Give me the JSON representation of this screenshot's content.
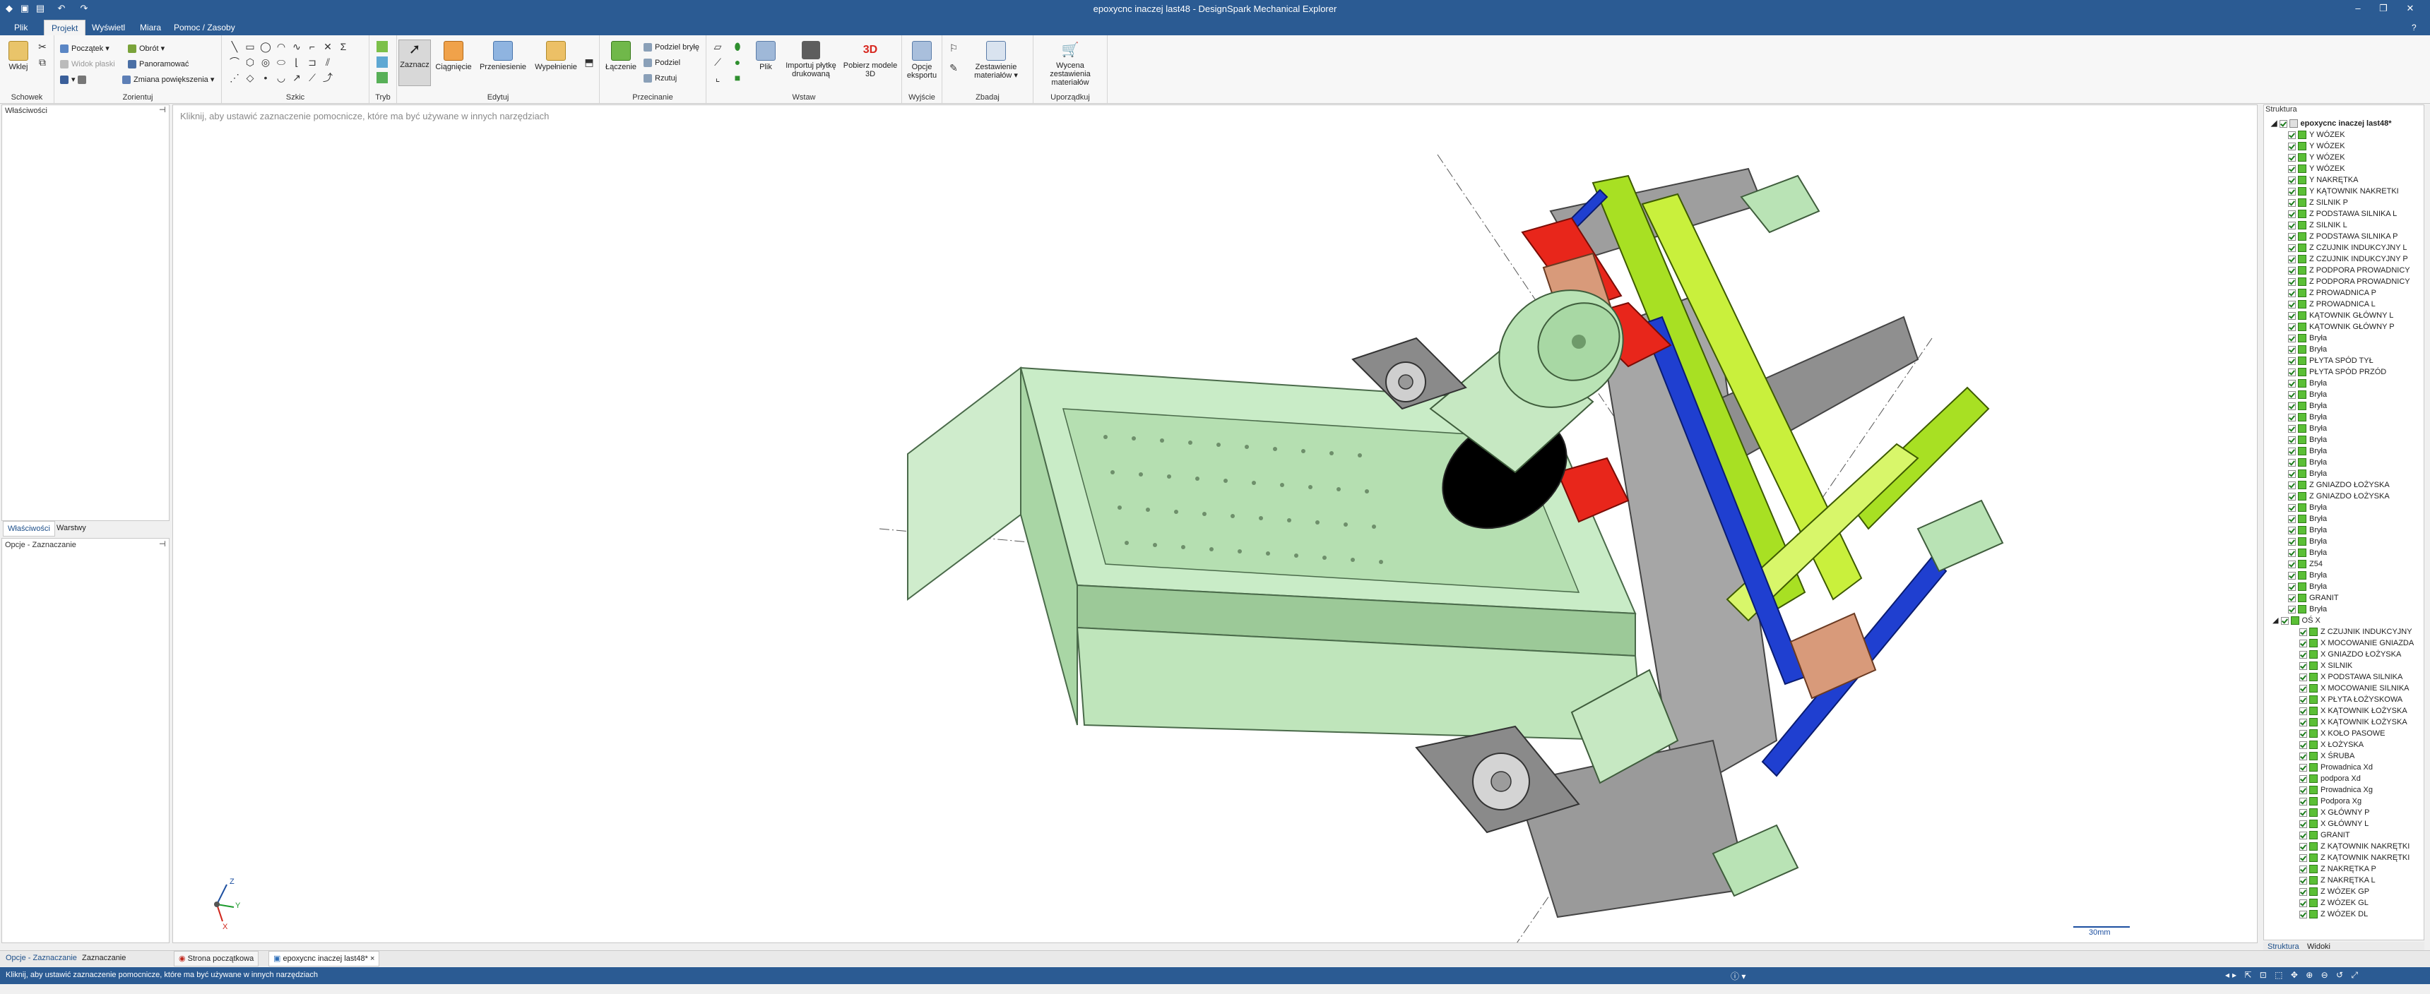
{
  "app": {
    "title": "epoxycnc inaczej last48 - DesignSpark Mechanical Explorer"
  },
  "menu": {
    "tabs": [
      "Plik",
      "Projekt",
      "Wyświetl",
      "Miara",
      "Pomoc / Zasoby"
    ],
    "active": "Projekt"
  },
  "ribbon": {
    "schowek": {
      "label": "Schowek",
      "paste": "Wklej"
    },
    "zorientuj": {
      "label": "Zorientuj",
      "poczatek": "Początek",
      "obrot": "Obrót",
      "widok_plaski": "Widok płaski",
      "panoramowac": "Panoramować",
      "zmiana": "Zmiana powiększenia"
    },
    "szkic": {
      "label": "Szkic"
    },
    "tryb": {
      "label": "Tryb"
    },
    "edytuj": {
      "label": "Edytuj",
      "zaznacz": "Zaznacz",
      "ciagniecie": "Ciągnięcie",
      "przeniesienie": "Przeniesienie",
      "wypelnienie": "Wypełnienie"
    },
    "przecinanie": {
      "label": "Przecinanie",
      "laczenie": "Łączenie",
      "podziel_brylę": "Podziel bryłę",
      "podziel": "Podziel",
      "rzutuj": "Rzutuj"
    },
    "wstaw": {
      "label": "Wstaw",
      "plik": "Plik",
      "importuj": "Importuj płytkę drukowaną",
      "pobierz": "Pobierz modele 3D"
    },
    "wyjscie": {
      "label": "Wyjście",
      "opcje": "Opcje eksportu"
    },
    "zbadaj": {
      "label": "Zbadaj",
      "zestawienie": "Zestawienie materiałów"
    },
    "uporzadkuj": {
      "label": "Uporządkuj",
      "wycena": "Wycena zestawienia materiałów"
    }
  },
  "left": {
    "properties_title": "Właściwości",
    "tabs": [
      "Właściwości",
      "Warstwy"
    ],
    "options_title": "Opcje - Zaznaczanie"
  },
  "viewport": {
    "hint": "Kliknij, aby ustawić zaznaczenie pomocnicze, które ma być używane w innych narzędziach",
    "scale": "30mm",
    "axes": {
      "z": "Z",
      "y": "Y",
      "x": "X"
    }
  },
  "structure": {
    "title": "Struktura",
    "root": "epoxycnc inaczej last48*",
    "items": [
      "Y WÓZEK",
      "Y WÓZEK",
      "Y WÓZEK",
      "Y WÓZEK",
      "Y NAKRĘTKA",
      "Y KĄTOWNIK NAKRETKI",
      "Z SILNIK P",
      "Z PODSTAWA SILNIKA L",
      "Z SILNIK L",
      "Z PODSTAWA SILNIKA P",
      "Z CZUJNIK INDUKCYJNY L",
      "Z CZUJNIK INDUKCYJNY P",
      "Z PODPORA PROWADNICY",
      "Z PODPORA PROWADNICY",
      "Z PROWADNICA P",
      "Z PROWADNICA L",
      "KĄTOWNIK GŁÓWNY L",
      "KĄTOWNIK GŁÓWNY P",
      "Bryła",
      "Bryła",
      "PŁYTA SPÓD TYŁ",
      "PŁYTA SPÓD PRZÓD",
      "Bryła",
      "Bryła",
      "Bryła",
      "Bryła",
      "Bryła",
      "Bryła",
      "Bryła",
      "Bryła",
      "Bryła",
      "Z GNIAZDO ŁOŻYSKA",
      "Z GNIAZDO ŁOŻYSKA",
      "Bryła",
      "Bryła",
      "Bryła",
      "Bryła",
      "Bryła",
      "Z54",
      "Bryła",
      "Bryła",
      "GRANIT",
      "Bryła",
      "OŚ X"
    ],
    "subitems": [
      "Z CZUJNIK INDUKCYJNY",
      "X MOCOWANIE GNIAZDA",
      "X GNIAZDO ŁOŻYSKA",
      "X SILNIK",
      "X PODSTAWA SILNIKA",
      "X MOCOWANIE SILNIKA",
      "X PŁYTA ŁOŻYSKOWA",
      "X KĄTOWNIK ŁOŻYSKA",
      "X KĄTOWNIK ŁOŻYSKA",
      "X KOŁO PASOWE",
      "X ŁOŻYSKA",
      "X ŚRUBA",
      "Prowadnica Xd",
      "podpora Xd",
      "Prowadnica Xg",
      "Podpora Xg",
      "X GŁÓWNY P",
      "X GŁÓWNY L",
      "GRANIT",
      "Z KĄTOWNIK NAKRĘTKI",
      "Z KĄTOWNIK NAKRĘTKI",
      "Z NAKRĘTKA P",
      "Z NAKRĘTKA L",
      "Z WÓZEK GP",
      "Z WÓZEK GL",
      "Z WÓZEK DL"
    ],
    "bottom_tabs": [
      "Struktura",
      "Widoki"
    ]
  },
  "bottom": {
    "left_tabs": [
      "Opcje - Zaznaczanie",
      "Zaznaczanie"
    ],
    "doc_tabs": [
      "Strona początkowa",
      "epoxycnc inaczej last48*"
    ]
  },
  "status": {
    "message": "Kliknij, aby ustawić zaznaczenie pomocnicze, które ma być używane w innych narzędziach"
  },
  "colors": {
    "titlebar": "#2b5b93",
    "part_green": "#b9e3b5",
    "lime": "#a8e023",
    "rail_blue": "#1f3fd0",
    "red": "#e8261b"
  }
}
